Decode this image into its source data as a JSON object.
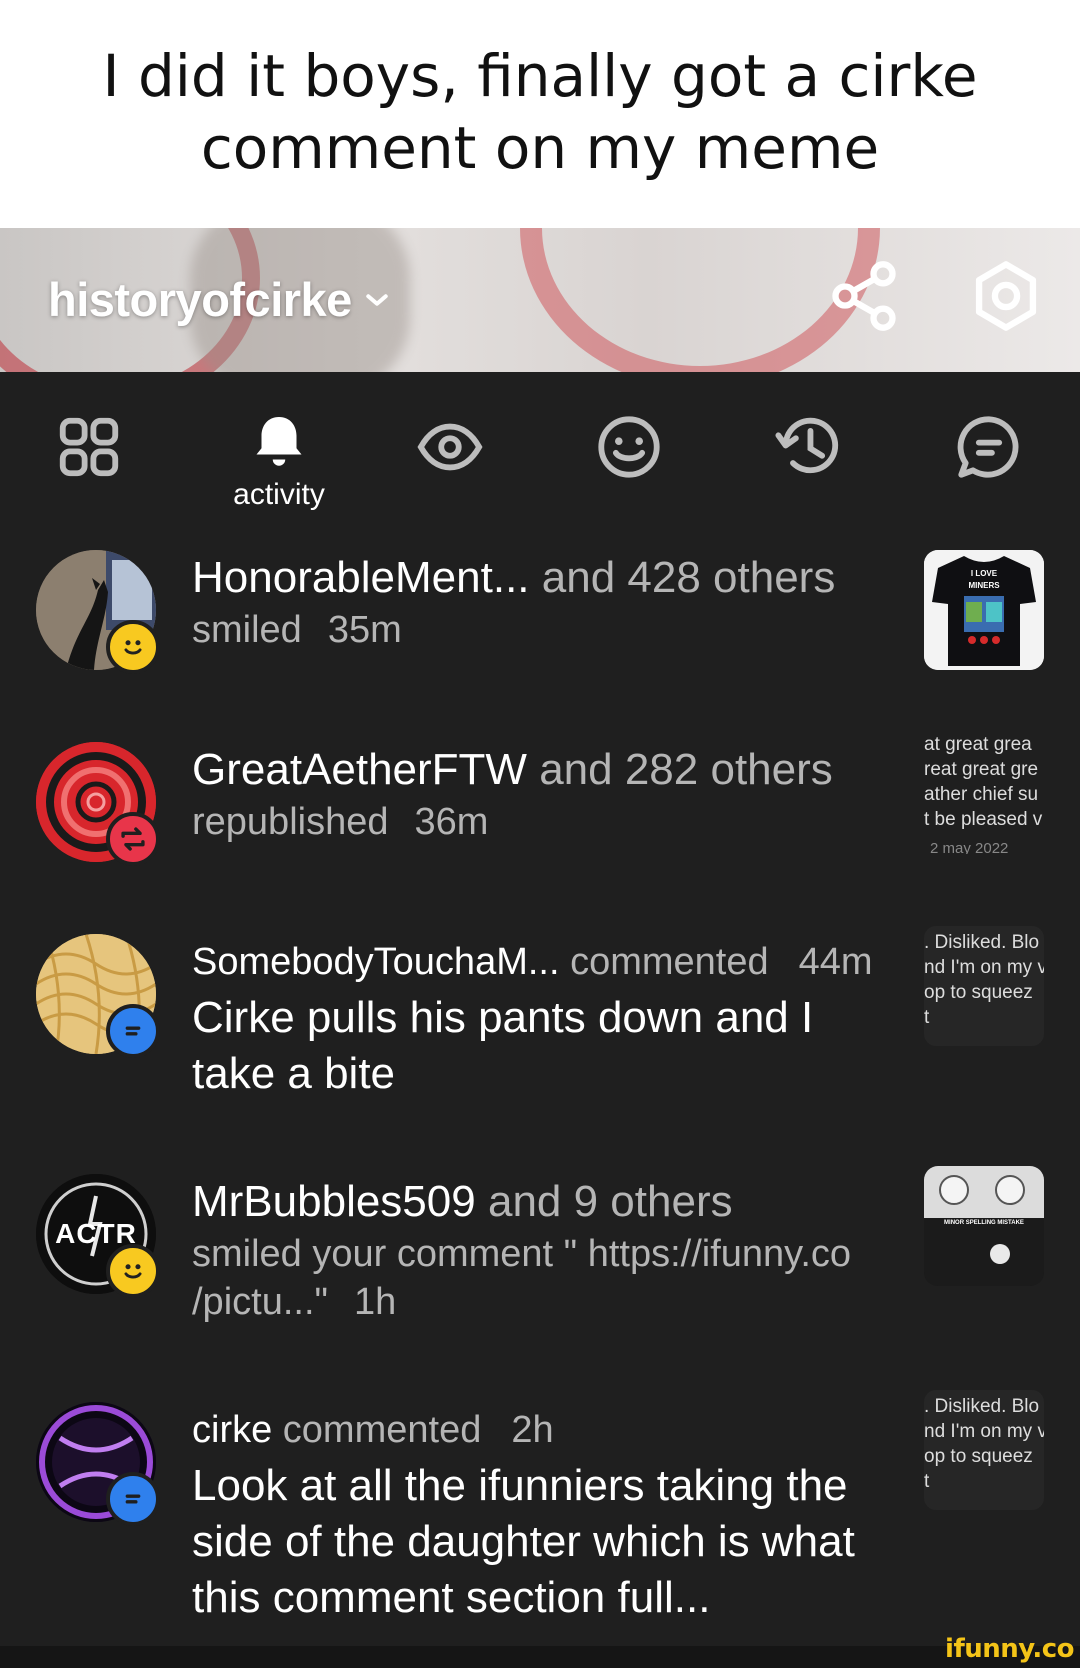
{
  "caption": "I did it boys, finally got a cirke comment on my meme",
  "header": {
    "username": "historyofcirke",
    "icons": [
      "chevron-down-icon",
      "share-icon",
      "settings-icon"
    ]
  },
  "tabs": [
    {
      "icon": "grid-icon",
      "label": ""
    },
    {
      "icon": "bell-icon",
      "label": "activity",
      "active": true
    },
    {
      "icon": "eye-icon",
      "label": ""
    },
    {
      "icon": "smiley-icon",
      "label": ""
    },
    {
      "icon": "history-icon",
      "label": ""
    },
    {
      "icon": "chat-bubble-icon",
      "label": ""
    }
  ],
  "feed": [
    {
      "user": "HonorableMent...",
      "rest": "and 428 others",
      "action": "smiled",
      "time": "35m",
      "badge": "smiley-badge-icon",
      "preview": {
        "type": "image",
        "text": "I LOVE MINERS"
      }
    },
    {
      "user": "GreatAetherFTW",
      "rest": "and 282 others",
      "action": "republished",
      "time": "36m",
      "badge": "republish-badge-icon",
      "preview": {
        "type": "text",
        "lines": [
          "at great grea",
          "reat great gre",
          "ather chief su",
          "t be pleased v"
        ],
        "date": "2 may 2022"
      }
    },
    {
      "user": "SomebodyTouchaM...",
      "action": "commented",
      "time": "44m",
      "comment": "Cirke pulls his pants down and I take a bite",
      "badge": "comment-badge-icon",
      "preview": {
        "type": "text",
        "lines": [
          ". Disliked. Blo",
          "nd I'm on my v",
          "op to squeez",
          "t"
        ]
      }
    },
    {
      "user": "MrBubbles509",
      "rest": "and 9 others",
      "action": "smiled your comment \" https://ifunny.co /pictu...\"",
      "time": "1h",
      "badge": "smiley-badge-icon",
      "avatar_text": "ACTR",
      "preview": {
        "type": "image",
        "text": "MINOR SPELLING MISTAKE"
      }
    },
    {
      "user": "cirke",
      "action": "commented",
      "time": "2h",
      "comment": "Look at all the ifunniers taking the side of the daughter which is what this comment section full...",
      "badge": "comment-badge-icon",
      "preview": {
        "type": "text",
        "lines": [
          ". Disliked. Blo",
          "nd I'm on my v",
          "op to squeez",
          "t"
        ]
      }
    }
  ],
  "watermark": "ifunny.co",
  "colors": {
    "background": "#1f1f1f",
    "muted_text": "#b5b5b5",
    "smile_badge": "#f8c920",
    "republish_badge": "#e8354a",
    "comment_badge": "#2f80ed",
    "watermark": "#f4c418"
  }
}
